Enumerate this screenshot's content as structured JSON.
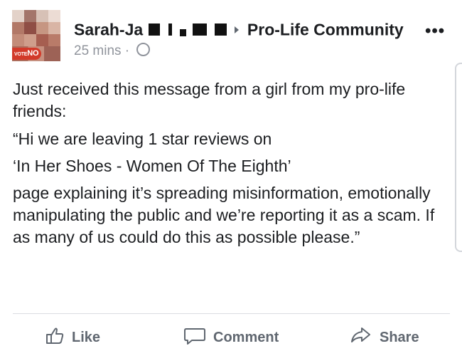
{
  "post": {
    "author_name": "Sarah-Ja",
    "group_name": "Pro-Life Community",
    "time": "25 mins ·",
    "badge_text": "VOTE",
    "badge_text2": "NO",
    "paragraphs": [
      "Just received this message from a girl from my pro-life friends:",
      "“Hi we are leaving 1 star reviews on",
      "‘In Her Shoes - Women Of The Eighth’",
      "page explaining it’s spreading misinformation, emotionally manipulating the public and we’re reporting it as a scam. If as many of us could do this as possible please.”"
    ]
  },
  "actions": {
    "like": "Like",
    "comment": "Comment",
    "share": "Share"
  },
  "icons": {
    "more": "more-options-icon",
    "privacy": "globe-icon",
    "like": "thumbs-up-icon",
    "comment": "comment-icon",
    "share": "share-icon"
  }
}
